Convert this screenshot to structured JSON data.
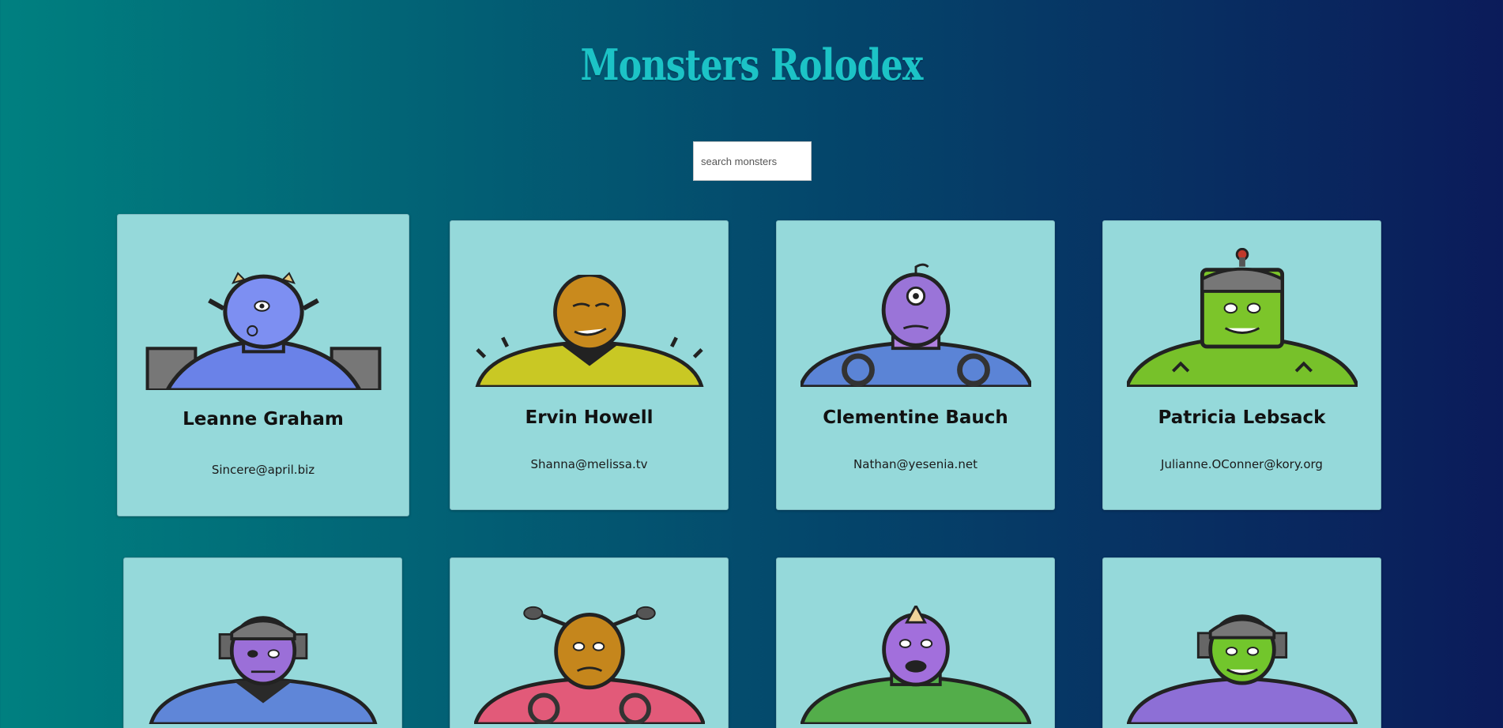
{
  "page": {
    "title": "Monsters Rolodex"
  },
  "search": {
    "placeholder": "search monsters"
  },
  "colors": {
    "title": "#1cc3c6",
    "card_background": "#95d9da",
    "background_start": "#008080",
    "background_end": "#0b1b5a"
  },
  "monsters": [
    {
      "name": "Leanne Graham",
      "email": "Sincere@april.biz",
      "head_color": "#7d8ff2",
      "body_color": "#6a82e8"
    },
    {
      "name": "Ervin Howell",
      "email": "Shanna@melissa.tv",
      "head_color": "#c98a1d",
      "body_color": "#c9c824"
    },
    {
      "name": "Clementine Bauch",
      "email": "Nathan@yesenia.net",
      "head_color": "#9a74d8",
      "body_color": "#5b84d6"
    },
    {
      "name": "Patricia Lebsack",
      "email": "Julianne.OConner@kory.org",
      "head_color": "#7cc52a",
      "body_color": "#77c12a"
    },
    {
      "name": "",
      "email": "",
      "head_color": "#9b6fd8",
      "body_color": "#5f86d8"
    },
    {
      "name": "",
      "email": "",
      "head_color": "#c5861c",
      "body_color": "#e25a79"
    },
    {
      "name": "",
      "email": "",
      "head_color": "#a26fdc",
      "body_color": "#53ad4a"
    },
    {
      "name": "",
      "email": "",
      "head_color": "#72c62c",
      "body_color": "#8d6fd6"
    }
  ]
}
